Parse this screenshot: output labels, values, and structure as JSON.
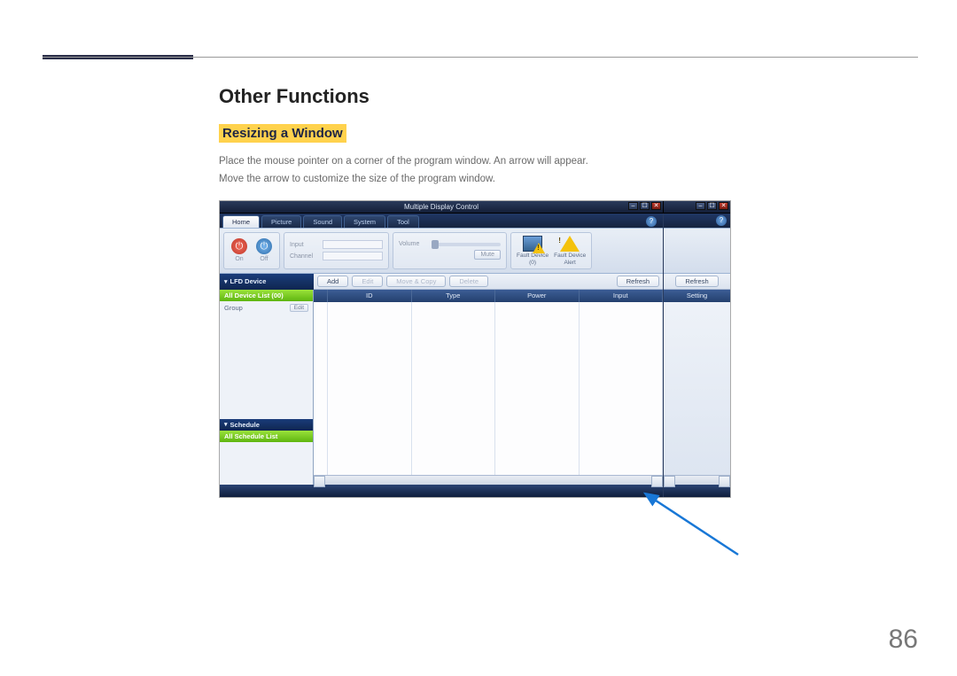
{
  "section_heading": "Other Functions",
  "subsection_heading": "Resizing a Window",
  "paragraph1": "Place the mouse pointer on a corner of the program window. An arrow will appear.",
  "paragraph2": "Move the arrow to customize the size of the program window.",
  "page_number": "86",
  "app": {
    "title": "Multiple Display Control",
    "tabs": [
      "Home",
      "Picture",
      "Sound",
      "System",
      "Tool"
    ],
    "active_tab_index": 0,
    "help_glyph": "?",
    "ribbon": {
      "power_on": "On",
      "power_off": "Off",
      "input_label": "Input",
      "channel_label": "Channel",
      "volume_label": "Volume",
      "mute_label": "Mute",
      "fault_device_count_label": "Fault Device",
      "fault_device_count_sub": "(0)",
      "fault_alert_label": "Fault Device",
      "fault_alert_sub": "Alert"
    },
    "buttons": {
      "add": "Add",
      "edit": "Edit",
      "move_copy": "Move & Copy",
      "delete": "Delete",
      "refresh": "Refresh"
    },
    "sidebar": {
      "lfd_header": "LFD Device",
      "all_device_list": "All Device List (00)",
      "group_label": "Group",
      "edit_label": "Edit",
      "schedule_header": "Schedule",
      "all_schedule_list": "All Schedule List"
    },
    "grid_columns": [
      "",
      "ID",
      "Type",
      "Power",
      "Input"
    ],
    "right_panel": {
      "refresh": "Refresh",
      "column": "Setting"
    },
    "win_controls": {
      "min": "–",
      "max": "☐",
      "close": "✕"
    }
  }
}
